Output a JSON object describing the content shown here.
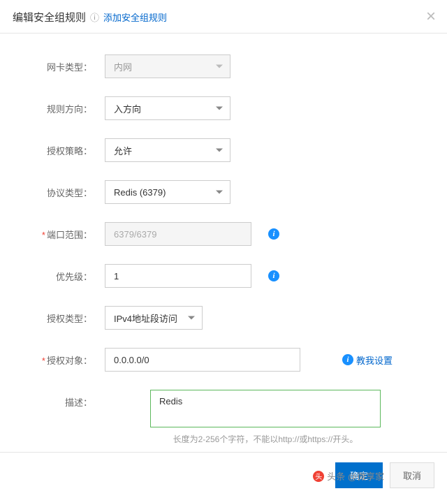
{
  "header": {
    "title": "编辑安全组规则",
    "add_link": "添加安全组规则"
  },
  "form": {
    "nic_type": {
      "label": "网卡类型：",
      "value": "内网"
    },
    "direction": {
      "label": "规则方向：",
      "value": "入方向"
    },
    "policy": {
      "label": "授权策略：",
      "value": "允许"
    },
    "protocol": {
      "label": "协议类型：",
      "value": "Redis (6379)"
    },
    "port_range": {
      "label": "端口范围：",
      "value": "6379/6379"
    },
    "priority": {
      "label": "优先级：",
      "value": "1"
    },
    "auth_type": {
      "label": "授权类型：",
      "value": "IPv4地址段访问"
    },
    "auth_object": {
      "label": "授权对象：",
      "value": "0.0.0.0/0",
      "help_link": "教我设置"
    },
    "description": {
      "label": "描述：",
      "value": "Redis",
      "hint": "长度为2-256个字符，不能以http://或https://开头。"
    }
  },
  "footer": {
    "ok": "确定",
    "cancel": "取消"
  },
  "watermark": "头条 @微享家"
}
